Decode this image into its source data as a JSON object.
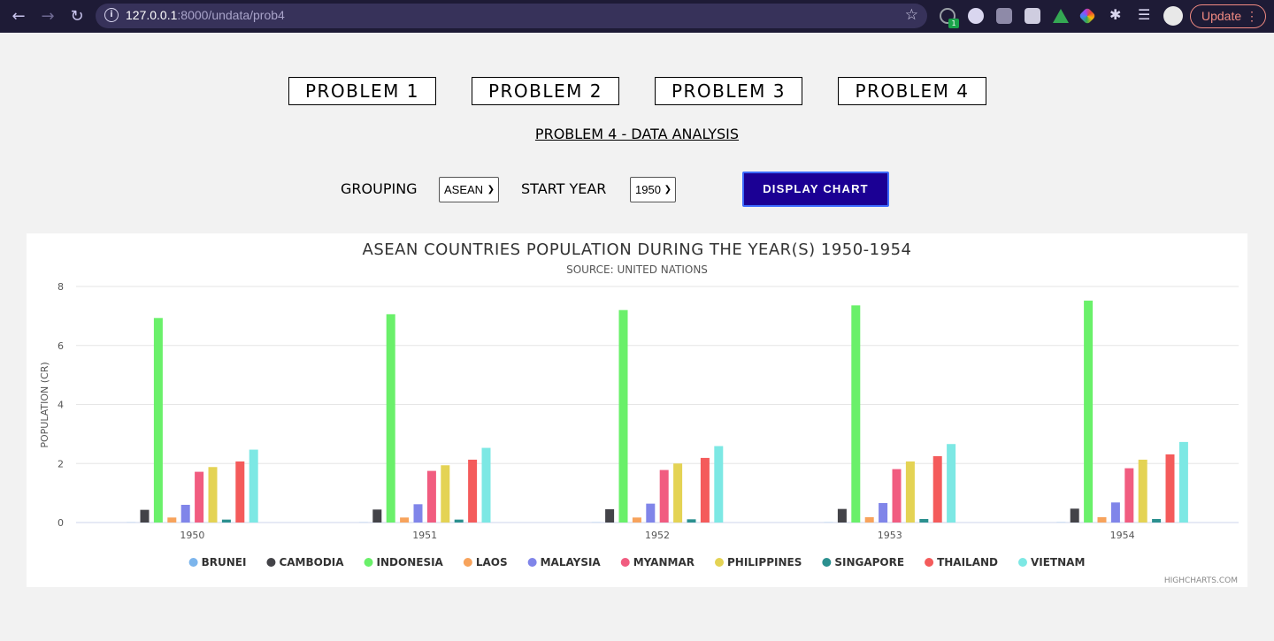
{
  "browser": {
    "url_host": "127.0.0.1",
    "url_rest": ":8000/undata/prob4",
    "ext_badge": "1",
    "update_label": "Update"
  },
  "nav_buttons": [
    "PROBLEM 1",
    "PROBLEM 2",
    "PROBLEM 3",
    "PROBLEM 4"
  ],
  "page_heading": "PROBLEM 4 - DATA ANALYSIS",
  "controls": {
    "grouping_label": "GROUPING",
    "grouping_value": "ASEAN",
    "start_year_label": "START YEAR",
    "start_year_value": "1950",
    "display_button": "DISPLAY CHART"
  },
  "chart_data": {
    "type": "bar",
    "title": "ASEAN COUNTRIES POPULATION DURING THE YEAR(S) 1950-1954",
    "subtitle": "SOURCE: UNITED NATIONS",
    "ylabel": "POPULATION (CR)",
    "xlabel": "",
    "ylim": [
      0,
      8
    ],
    "yticks": [
      0,
      2,
      4,
      6,
      8
    ],
    "categories": [
      "1950",
      "1951",
      "1952",
      "1953",
      "1954"
    ],
    "credits": "HIGHCHARTS.COM",
    "legend_position": "bottom",
    "series": [
      {
        "name": "BRUNEI",
        "color": "#7cb5ec",
        "values": [
          0.005,
          0.005,
          0.006,
          0.006,
          0.007
        ]
      },
      {
        "name": "CAMBODIA",
        "color": "#434348",
        "values": [
          0.43,
          0.44,
          0.45,
          0.46,
          0.47
        ]
      },
      {
        "name": "INDONESIA",
        "color": "#6af06a",
        "values": [
          6.93,
          7.06,
          7.2,
          7.36,
          7.52
        ]
      },
      {
        "name": "LAOS",
        "color": "#f7a35c",
        "values": [
          0.17,
          0.17,
          0.17,
          0.18,
          0.18
        ]
      },
      {
        "name": "MALAYSIA",
        "color": "#8085e9",
        "values": [
          0.6,
          0.62,
          0.64,
          0.66,
          0.68
        ]
      },
      {
        "name": "MYANMAR",
        "color": "#f15c80",
        "values": [
          1.72,
          1.75,
          1.78,
          1.81,
          1.84
        ]
      },
      {
        "name": "PHILIPPINES",
        "color": "#e4d354",
        "values": [
          1.88,
          1.94,
          2.0,
          2.07,
          2.13
        ]
      },
      {
        "name": "SINGAPORE",
        "color": "#2b908f",
        "values": [
          0.1,
          0.1,
          0.11,
          0.12,
          0.12
        ]
      },
      {
        "name": "THAILAND",
        "color": "#f45b5b",
        "values": [
          2.07,
          2.13,
          2.19,
          2.25,
          2.31
        ]
      },
      {
        "name": "VIETNAM",
        "color": "#7de8e4",
        "values": [
          2.47,
          2.53,
          2.59,
          2.66,
          2.73
        ]
      }
    ]
  }
}
